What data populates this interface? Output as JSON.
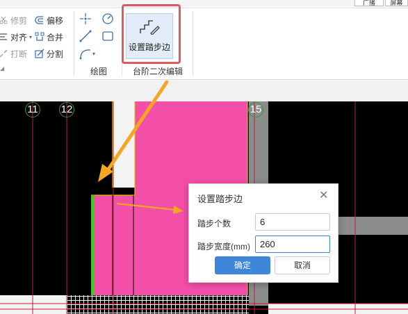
{
  "ribbon": {
    "top_tabs": [
      "广播",
      "屏幕"
    ],
    "modify_group": {
      "trim": "修剪",
      "align": "对齐",
      "break": "打断",
      "offset": "偏移",
      "merge": "合并",
      "split": "分割"
    },
    "draw_group": {
      "label": "绘图"
    },
    "step_group": {
      "button_label": "设置踏步边",
      "label": "台阶二次编辑"
    }
  },
  "canvas": {
    "axis_labels": [
      "11",
      "12",
      "15"
    ],
    "colors": {
      "background": "#000000",
      "step_fill": "#f44fa8",
      "gray_wall": "#8c8c8c",
      "axis_line": "#c0212b",
      "step_edge": "#34d017",
      "arrow": "#f5a623"
    }
  },
  "dialog": {
    "title": "设置踏步边",
    "close_symbol": "✕",
    "fields": [
      {
        "label": "踏步个数",
        "value": "6"
      },
      {
        "label": "踏步宽度(mm)",
        "value": "260"
      }
    ],
    "confirm_label": "确定",
    "cancel_label": "取消"
  }
}
